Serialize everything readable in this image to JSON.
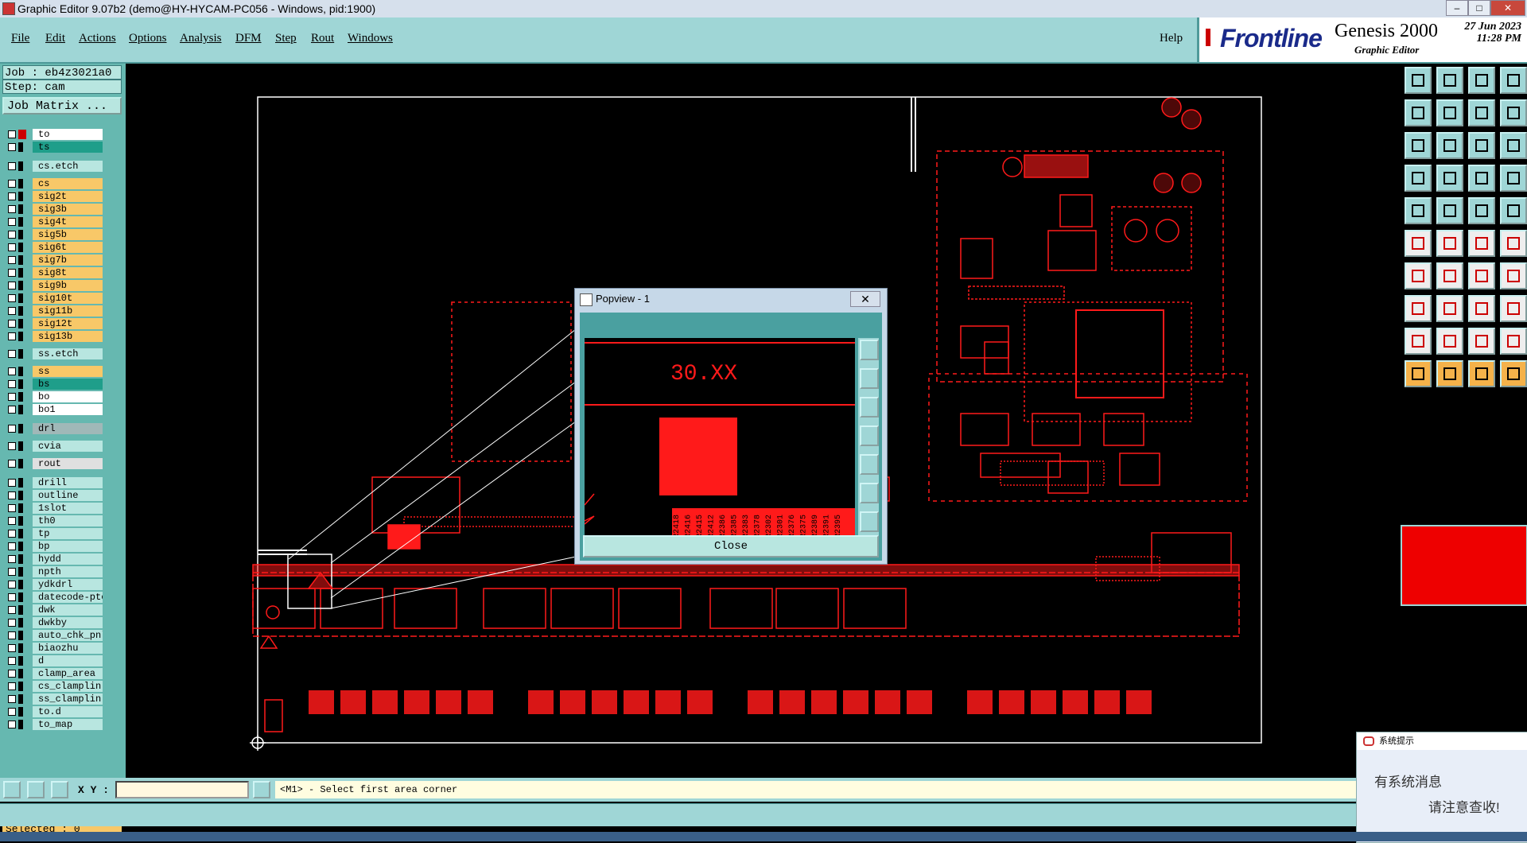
{
  "window": {
    "title": "Graphic Editor 9.07b2 (demo@HY-HYCAM-PC056 - Windows, pid:1900)"
  },
  "menu": {
    "items": [
      "File",
      "Edit",
      "Actions",
      "Options",
      "Analysis",
      "DFM",
      "Step",
      "Rout",
      "Windows"
    ],
    "help": "Help"
  },
  "brand": {
    "logo": "Frontline",
    "product": "Genesis 2000",
    "sub": "Graphic Editor",
    "date": "27 Jun 2023",
    "time": "11:28 PM"
  },
  "job": {
    "job_label": "Job : eb4z3021a0",
    "step_label": "Step: cam",
    "matrix_button": "Job Matrix ..."
  },
  "layers": [
    {
      "name": "to",
      "color": "#ffffff"
    },
    {
      "name": "ts",
      "color": "#1f9e8a"
    },
    {
      "name": "cs.etch",
      "color": "#b8e6e0"
    },
    {
      "name": "cs",
      "color": "#f8c868"
    },
    {
      "name": "sig2t",
      "color": "#f8c868"
    },
    {
      "name": "sig3b",
      "color": "#f8c868"
    },
    {
      "name": "sig4t",
      "color": "#f8c868"
    },
    {
      "name": "sig5b",
      "color": "#f8c868"
    },
    {
      "name": "sig6t",
      "color": "#f8c868"
    },
    {
      "name": "sig7b",
      "color": "#f8c868"
    },
    {
      "name": "sig8t",
      "color": "#f8c868"
    },
    {
      "name": "sig9b",
      "color": "#f8c868"
    },
    {
      "name": "sig10t",
      "color": "#f8c868"
    },
    {
      "name": "sig11b",
      "color": "#f8c868"
    },
    {
      "name": "sig12t",
      "color": "#f8c868"
    },
    {
      "name": "sig13b",
      "color": "#f8c868"
    },
    {
      "name": "ss.etch",
      "color": "#b8e6e0"
    },
    {
      "name": "ss",
      "color": "#f8c868"
    },
    {
      "name": "bs",
      "color": "#1f9e8a"
    },
    {
      "name": "bo",
      "color": "#ffffff"
    },
    {
      "name": "bo1",
      "color": "#ffffff"
    },
    {
      "name": "drl",
      "color": "#a0b8b8"
    },
    {
      "name": "cvia",
      "color": "#b8e6e0"
    },
    {
      "name": "rout",
      "color": "#e0e0e0"
    },
    {
      "name": "drill",
      "color": "#b8e6e0"
    },
    {
      "name": "outline",
      "color": "#b8e6e0"
    },
    {
      "name": "1slot",
      "color": "#b8e6e0"
    },
    {
      "name": "th0",
      "color": "#b8e6e0"
    },
    {
      "name": "tp",
      "color": "#b8e6e0"
    },
    {
      "name": "bp",
      "color": "#b8e6e0"
    },
    {
      "name": "hydd",
      "color": "#b8e6e0"
    },
    {
      "name": "npth",
      "color": "#b8e6e0"
    },
    {
      "name": "ydkdrl",
      "color": "#b8e6e0"
    },
    {
      "name": "datecode-pte",
      "color": "#b8e6e0"
    },
    {
      "name": "dwk",
      "color": "#b8e6e0"
    },
    {
      "name": "dwkby",
      "color": "#b8e6e0"
    },
    {
      "name": "auto_chk_pnl",
      "color": "#b8e6e0"
    },
    {
      "name": "biaozhu",
      "color": "#b8e6e0"
    },
    {
      "name": "d",
      "color": "#b8e6e0"
    },
    {
      "name": "clamp_area",
      "color": "#b8e6e0"
    },
    {
      "name": "cs_clamplin",
      "color": "#b8e6e0"
    },
    {
      "name": "ss_clamplin",
      "color": "#b8e6e0"
    },
    {
      "name": "to.d",
      "color": "#b8e6e0"
    },
    {
      "name": "to_map",
      "color": "#b8e6e0"
    }
  ],
  "selected": "Selected : 0",
  "coords": {
    "label": "X Y :",
    "value": ""
  },
  "prompt": "<M1> - Select first area corner",
  "popview": {
    "title": "Popview - 1",
    "label": "30.XX",
    "close": "Close",
    "refs": [
      "R2418",
      "R2416",
      "R2415",
      "R2412",
      "R2386",
      "R2385",
      "R2383",
      "R2378",
      "R2302",
      "R2301",
      "R2376",
      "R2375",
      "R2389",
      "R2391",
      "R2395"
    ]
  },
  "sys_popup": {
    "title": "系统提示",
    "line1": "有系统消息",
    "line2": "请注意查收!"
  },
  "colors": {
    "accent": "#9fd6d6",
    "board": "#ff1a1a",
    "bg": "#000000"
  }
}
